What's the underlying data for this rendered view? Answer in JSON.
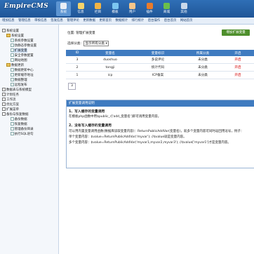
{
  "header": {
    "logo": "EmpireCMS",
    "nav": [
      {
        "label": "系统",
        "icon": "gear-icon",
        "color": "#e9eef6"
      },
      {
        "label": "信息",
        "icon": "document-icon",
        "color": "#f3d36b"
      },
      {
        "label": "栏目",
        "icon": "folder-icon",
        "color": "#f1b445"
      },
      {
        "label": "模板",
        "icon": "template-icon",
        "color": "#7cc6f0"
      },
      {
        "label": "用户",
        "icon": "user-icon",
        "color": "#f3c58a"
      },
      {
        "label": "插件",
        "icon": "plugin-icon",
        "color": "#e97b2b"
      },
      {
        "label": "商城",
        "icon": "shop-icon",
        "color": "#6bbf4a"
      },
      {
        "label": "其他",
        "icon": "other-icon",
        "color": "#c9d8ea"
      }
    ]
  },
  "subnav": [
    "增加信息",
    "管理信息",
    "审核信息",
    "签发信息",
    "管理评论",
    "更新数据",
    "更新首页",
    "数据统计",
    "排行统计",
    "后台操作",
    "后台首页",
    "网站首页"
  ],
  "sidebar": [
    {
      "label": "系统设置",
      "type": "box",
      "indent": 0
    },
    {
      "label": "系统设置",
      "type": "fld",
      "indent": 1
    },
    {
      "label": "系统参数设置",
      "type": "doc",
      "indent": 2
    },
    {
      "label": "伪静态参数设置",
      "type": "doc",
      "indent": 2
    },
    {
      "label": "扩展变量",
      "type": "doc",
      "indent": 2,
      "selected": true
    },
    {
      "label": "安全参数配置",
      "type": "doc",
      "indent": 2
    },
    {
      "label": "网站地图",
      "type": "doc",
      "indent": 2
    },
    {
      "label": "数据更新",
      "type": "fld",
      "indent": 1
    },
    {
      "label": "数据更新中心",
      "type": "doc",
      "indent": 2
    },
    {
      "label": "更新缓存地址",
      "type": "doc",
      "indent": 2
    },
    {
      "label": "数据整理",
      "type": "doc",
      "indent": 2
    },
    {
      "label": "远程发布",
      "type": "doc",
      "indent": 2
    },
    {
      "label": "数据表与系统模型",
      "type": "box",
      "indent": 0
    },
    {
      "label": "计划任务",
      "type": "box",
      "indent": 0
    },
    {
      "label": "工作流",
      "type": "box",
      "indent": 0
    },
    {
      "label": "优化方案",
      "type": "box",
      "indent": 0
    },
    {
      "label": "扩展菜单",
      "type": "box",
      "indent": 0
    },
    {
      "label": "备份与恢复数据",
      "type": "box",
      "indent": 0
    },
    {
      "label": "备份数据",
      "type": "doc",
      "indent": 2
    },
    {
      "label": "恢复数据",
      "type": "doc",
      "indent": 2
    },
    {
      "label": "管理备份目录",
      "type": "doc",
      "indent": 2
    },
    {
      "label": "执行SQL语句",
      "type": "doc",
      "indent": 2
    }
  ],
  "main": {
    "breadcrumb": "位置: 管理扩展变量",
    "add_button": "增加扩展变量",
    "filter_label": "选择分类:",
    "filter_value": "显示所有分类",
    "columns": [
      "ID",
      "变量名",
      "变量标识",
      "所属分类",
      "开启"
    ],
    "rows": [
      {
        "id": "3",
        "name": "duoshuo",
        "label": "多说评论",
        "cat": "未分类",
        "open": "开启"
      },
      {
        "id": "2",
        "name": "tongji",
        "label": "统计代码",
        "cat": "未分类",
        "open": "开启"
      },
      {
        "id": "1",
        "name": "icp",
        "label": "ICP备案",
        "cat": "未分类",
        "open": "开启"
      }
    ],
    "page": "3"
  },
  "help": {
    "title": "扩展变量调用说明",
    "lines": [
      {
        "text": "1、写入缓存的变量调用",
        "bold": true
      },
      {
        "text": "在模板php函数中用$public_r['add_变量名']即可调用变量内容。",
        "bold": false
      },
      {
        "text": "2、没有写入缓存的变量调用",
        "bold": true
      },
      {
        "text": "可以用内置变量调用函数(数据库读取变量内容)：ReturnPublicAddVar(变量名)，就多个变量内容可同时返回用逗号，例子：",
        "bold": false
      },
      {
        "text": "单个变量内容：$value=ReturnPublicAddVar('myvar'); //$value就是变量内容。",
        "bold": false
      },
      {
        "text": "多个变量内容：$value=ReturnPublicAddVar('myvar1,myvar2,myvar3'); //$value['myvar1']才是变量内容。",
        "bold": false
      }
    ]
  }
}
